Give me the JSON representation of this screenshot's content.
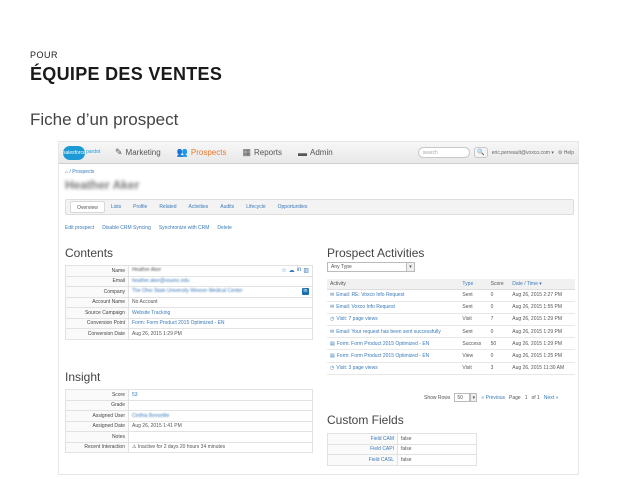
{
  "slide": {
    "kicker": "POUR",
    "title": "ÉQUIPE DES VENTES",
    "subtitle": "Fiche d’un prospect"
  },
  "nav": {
    "logo_text": "salesforce",
    "logo_suffix": "pardot",
    "items": [
      {
        "label": "Marketing",
        "icon": "wrench-icon",
        "glyph": "✎"
      },
      {
        "label": "Prospects",
        "icon": "people-icon",
        "glyph": "👥"
      },
      {
        "label": "Reports",
        "icon": "chart-icon",
        "glyph": "▦"
      },
      {
        "label": "Admin",
        "icon": "admin-icon",
        "glyph": "▬"
      }
    ],
    "search_placeholder": "search",
    "user": "eric.perreault@voxco.com ▾",
    "help": "⚙ Help"
  },
  "breadcrumb": "⌂ / Prospects",
  "prospect_name": "Heather Aker",
  "tabs": [
    "Overview",
    "Lists",
    "Profile",
    "Related",
    "Activities",
    "Audits",
    "Lifecycle",
    "Opportunities"
  ],
  "actions": [
    "Edit prospect",
    "Disable CRM Syncing",
    "Synchronize with CRM",
    "Delete"
  ],
  "contents": {
    "heading": "Contents",
    "rows": [
      {
        "label": "Name",
        "value": "Heather Aker"
      },
      {
        "label": "Email",
        "value": "heather.aker@osumc.edu"
      },
      {
        "label": "Company",
        "value": "The Ohio State University Wexner Medical Center"
      },
      {
        "label": "Account Name",
        "value": "No Account"
      },
      {
        "label": "Source Campaign",
        "value": "Website Tracking"
      },
      {
        "label": "Conversion Point",
        "value": "Form: Form Product 2015 Optimized - EN"
      },
      {
        "label": "Conversion Date",
        "value": "Aug 26, 2015 1:29 PM"
      }
    ]
  },
  "insight": {
    "heading": "Insight",
    "rows": [
      {
        "label": "Score",
        "value": "53"
      },
      {
        "label": "Grade",
        "value": ""
      },
      {
        "label": "Assigned User",
        "value": "Cinthia Bonsellie"
      },
      {
        "label": "Assigned Date",
        "value": "Aug 26, 2015 1:41 PM"
      },
      {
        "label": "Notes",
        "value": ""
      },
      {
        "label": "Recent Interaction",
        "value": "⚠ Inactive for 2 days 20 hours 34 minutes"
      }
    ]
  },
  "activities": {
    "heading": "Prospect Activities",
    "filter": "Any Type",
    "columns": [
      "Activity",
      "Type",
      "Score",
      "Date / Time ▾"
    ],
    "rows": [
      {
        "icon": "✉",
        "activity": "Email: RE: Voxco Info Request",
        "type": "Sent",
        "score": "0",
        "date": "Aug 26, 2015 2:27 PM"
      },
      {
        "icon": "✉",
        "activity": "Email: Voxco Info Request",
        "type": "Sent",
        "score": "0",
        "date": "Aug 26, 2015 1:55 PM"
      },
      {
        "icon": "◷",
        "activity": "Visit: 7 page views",
        "type": "Visit",
        "score": "7",
        "date": "Aug 26, 2015 1:29 PM"
      },
      {
        "icon": "✉",
        "activity": "Email: Your request has been sent successfully",
        "type": "Sent",
        "score": "0",
        "date": "Aug 26, 2015 1:29 PM"
      },
      {
        "icon": "▤",
        "activity": "Form: Form Product 2015 Optimized - EN",
        "type": "Success",
        "score": "50",
        "date": "Aug 26, 2015 1:29 PM"
      },
      {
        "icon": "▤",
        "activity": "Form: Form Product 2015 Optimized - EN",
        "type": "View",
        "score": "0",
        "date": "Aug 26, 2015 1:25 PM"
      },
      {
        "icon": "◷",
        "activity": "Visit: 3 page views",
        "type": "Visit",
        "score": "3",
        "date": "Aug 26, 2015 11:30 AM"
      }
    ],
    "pager": {
      "show_rows_label": "Show Rows",
      "rows": "50",
      "previous": "« Previous",
      "page_label": "Page",
      "page": "1",
      "of": "of 1",
      "next": "Next »"
    }
  },
  "custom_fields": {
    "heading": "Custom Fields",
    "rows": [
      {
        "label": "Field CAM",
        "value": "false"
      },
      {
        "label": "Field CAPI",
        "value": "false"
      },
      {
        "label": "Field CASL",
        "value": "false"
      }
    ]
  },
  "colors": {
    "accent": "#e8772e",
    "link": "#3a7ab8",
    "brand": "#1b9ad6"
  }
}
